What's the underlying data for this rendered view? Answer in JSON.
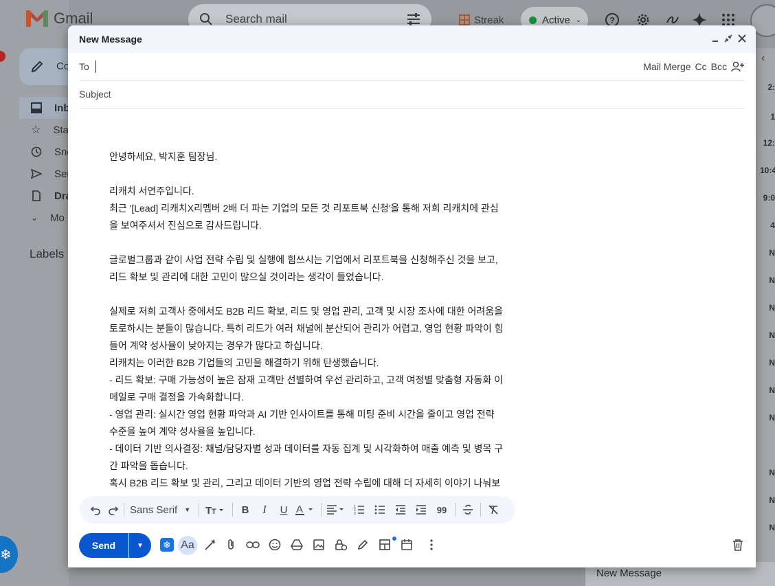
{
  "background": {
    "app_name": "Gmail",
    "search_placeholder": "Search mail",
    "streak_label": "Streak",
    "status_label": "Active",
    "nav": [
      {
        "label": "Co"
      },
      {
        "label": "Inb"
      },
      {
        "label": "Sta"
      },
      {
        "label": "Sno"
      },
      {
        "label": "Sen"
      },
      {
        "label": "Dra"
      },
      {
        "label": "Mo"
      }
    ],
    "labels_heading": "Labels",
    "right_times": [
      "2:",
      "1",
      "12:",
      "10:4",
      "9:0",
      "4",
      "N",
      "N",
      "N",
      "N",
      "N",
      "N",
      "N",
      "N",
      "N",
      "N"
    ],
    "minimized_compose_title": "New Message"
  },
  "compose": {
    "title": "New Message",
    "to_label": "To",
    "to_value": "",
    "to_links": {
      "mail_merge": "Mail Merge",
      "cc": "Cc",
      "bcc": "Bcc"
    },
    "subject_placeholder": "Subject",
    "body": {
      "greeting": "안녕하세요, 박지훈 팀장님.",
      "intro": "리캐치 서연주입니다.",
      "line1": "최근 '[Lead] 리캐치X리멤버 2배 더 파는 기업의 모든 것 리포트북 신청'을 통해 저희 리캐치에 관심",
      "line2": "을 보여주셔서 진심으로 감사드립니다.",
      "line3": "글로벌그룹과 같이 사업 전략 수립 및 실행에 힘쓰시는 기업에서 리포트북을 신청해주신 것을 보고,",
      "line4": "리드 확보 및 관리에 대한 고민이 많으실 것이라는 생각이 들었습니다.",
      "line5": "실제로 저희 고객사 중에서도 B2B 리드 확보, 리드 및 영업 관리, 고객 및 시장 조사에 대한 어려움을",
      "line6": "토로하시는 분들이 많습니다. 특히 리드가 여러 채널에 분산되어 관리가 어렵고, 영업 현황 파악이 힘",
      "line7": "들어 계약 성사율이 낮아지는 경우가 많다고 하십니다.",
      "line8": "리캐치는 이러한 B2B 기업들의 고민을 해결하기 위해 탄생했습니다.",
      "line9": "- 리드 확보: 구매 가능성이 높은 잠재 고객만 선별하여 우선 관리하고, 고객 여정별 맞춤형 자동화 이",
      "line10": "메일로 구매 결정을 가속화합니다.",
      "line11": "- 영업 관리: 실시간 영업 현황 파악과 AI 기반 인사이트를 통해 미팅 준비 시간을 줄이고 영업 전략",
      "line12": "수준을 높여 계약 성사율을 높입니다.",
      "line13": "- 데이터 기반 의사결정: 채널/담당자별 성과 데이터를 자동 집계 및 시각화하여 매출 예측 및 병목 구",
      "line14": "간 파악을 돕습니다.",
      "line15": "혹시 B2B 리드 확보 및 관리, 그리고 데이터 기반의 영업 전략 수립에 대해 더 자세히 이야기 나눠보"
    },
    "toolbar": {
      "font_name": "Sans Serif"
    },
    "send_label": "Send",
    "accent_color": "#0b57d0"
  }
}
